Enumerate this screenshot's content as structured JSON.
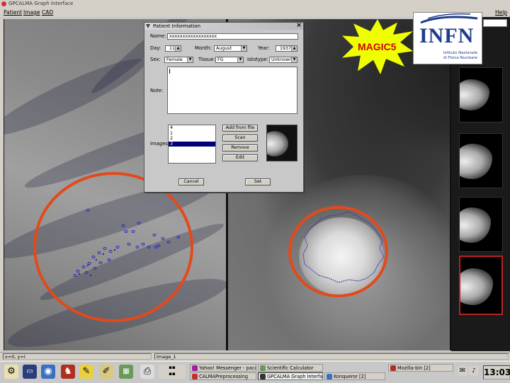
{
  "window": {
    "title": "GPCALMA Graph Interface"
  },
  "menu": {
    "patient": "Patient",
    "image": "Image",
    "cad": "CAD",
    "help": "Help"
  },
  "status": {
    "coords": "x=0, y=I",
    "image_name": "image_1"
  },
  "magic_label": "MAGIC5",
  "infn": {
    "logo": "INFN",
    "line1": "Istituto Nazionale",
    "line2": "di Fisica Nucleare"
  },
  "dialog": {
    "title": "Patient Information",
    "name_label": "Name:",
    "name_value": "xxxxxxxxxxxxxxxxxx",
    "day_label": "Day:",
    "day_value": "11",
    "month_label": "Month:",
    "month_value": "August",
    "year_label": "Year:",
    "year_value": "1937",
    "sex_label": "Sex:",
    "sex_value": "Female",
    "tissue_label": "Tissue:",
    "tissue_value": "FG",
    "istotype_label": "Istotype:",
    "istotype_value": "Unknown",
    "note_label": "Note:",
    "images_label": "Images:",
    "images": [
      "4",
      "1",
      "2",
      "3"
    ],
    "selected_image": "3",
    "add_from_file": "Add from file",
    "scan": "Scan",
    "remove": "Remove",
    "edit": "Edit",
    "cancel": "Cancel",
    "set": "Set"
  },
  "taskbar": {
    "tasks": [
      {
        "label": "Yahoo! Messenger - paco",
        "active": false
      },
      {
        "label": "Scientific Calculator",
        "active": false
      },
      {
        "label": "CALMAPreprocessing",
        "active": false
      },
      {
        "label": "GPCALMA Graph Interfa",
        "active": true
      },
      {
        "label": "Konqueror [2]",
        "active": false
      },
      {
        "label": "Mozilla-bin [2]",
        "active": false
      }
    ],
    "clock": "13:03"
  },
  "colors": {
    "annotation_circle": "#e24a1c",
    "selection": "#00007a",
    "burst": "#f0ff00",
    "magic_text": "#d40000"
  }
}
